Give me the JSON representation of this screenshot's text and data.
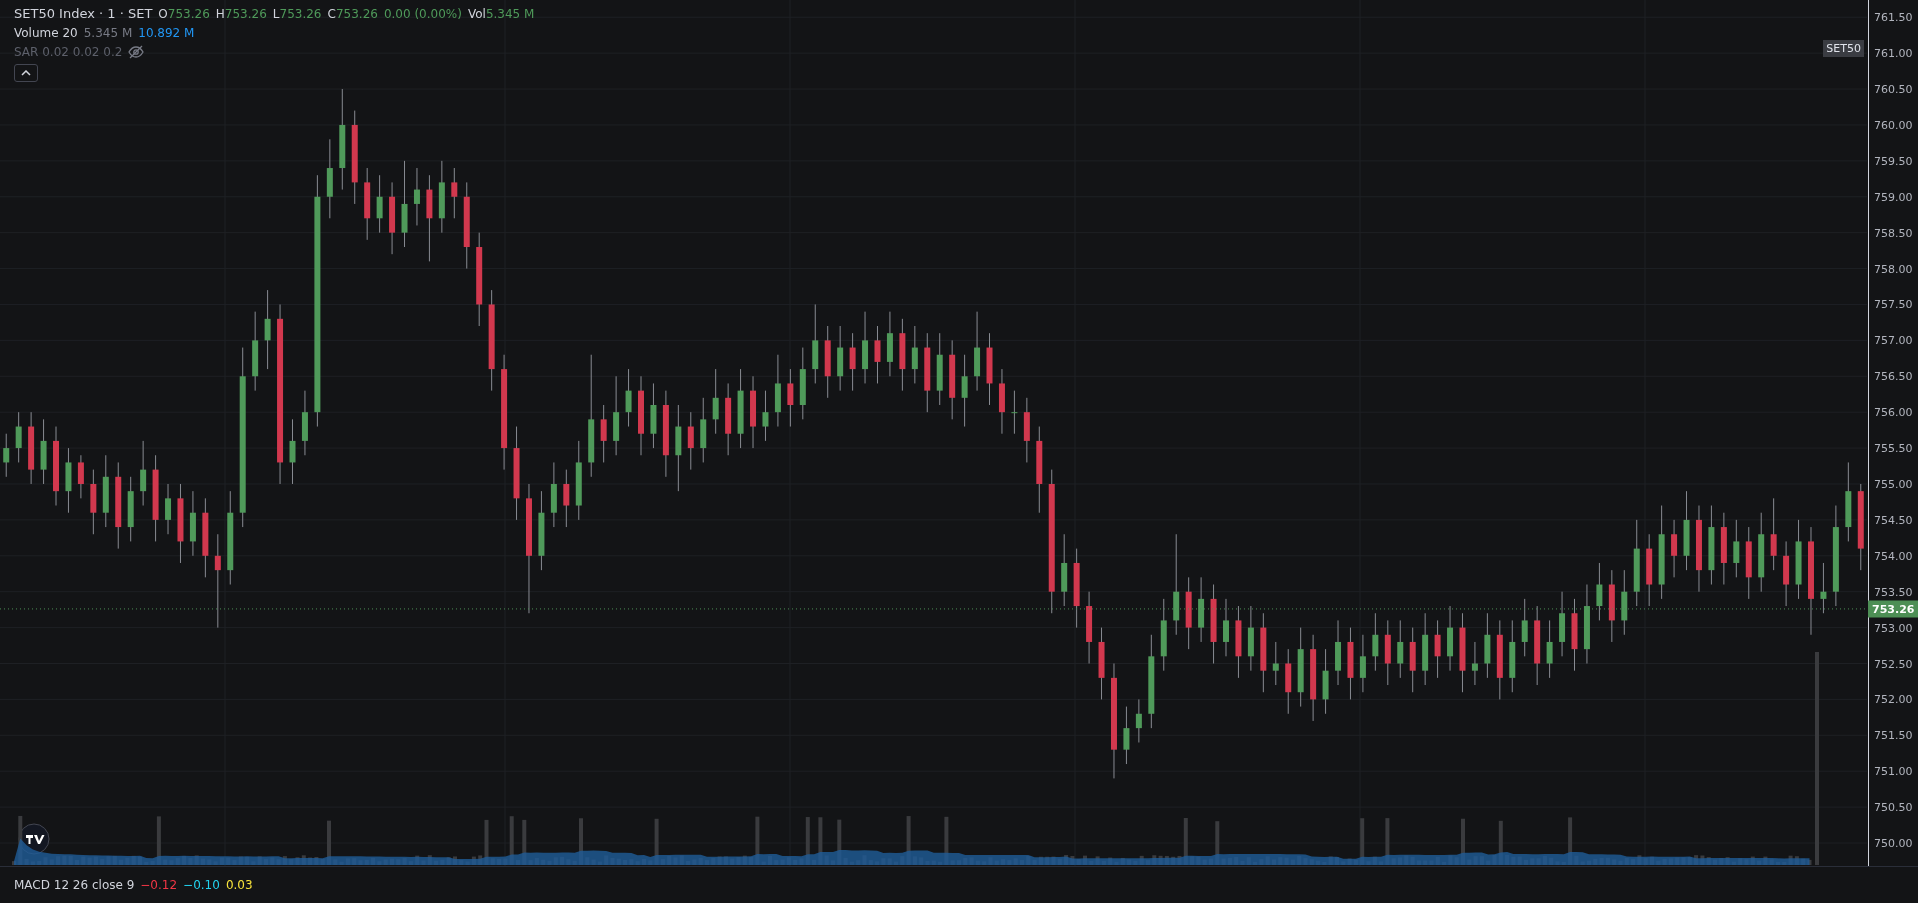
{
  "legend": {
    "title": "SET50 Index · 1 · SET",
    "ohlc": [
      {
        "label": "O",
        "value": "753.26"
      },
      {
        "label": "H",
        "value": "753.26"
      },
      {
        "label": "L",
        "value": "753.26"
      },
      {
        "label": "C",
        "value": "753.26"
      }
    ],
    "change": "0.00 (0.00%)",
    "volume_label": "Vol",
    "volume_value": "5.345 M"
  },
  "indicators": [
    {
      "name": "Volume 20",
      "values": [
        {
          "text": "5.345 M",
          "color": "#787b86"
        },
        {
          "text": "10.892 M",
          "color": "#2196f3"
        }
      ],
      "hidden": false
    },
    {
      "name": "SAR 0.02 0.02 0.2",
      "hidden": true
    }
  ],
  "chart": {
    "chart_data": {
      "type": "candlestick",
      "yticks": [
        {
          "value": 761.5,
          "label": "761.50"
        },
        {
          "value": 761,
          "label": "761.00"
        },
        {
          "value": 760.5,
          "label": "760.50"
        },
        {
          "value": 760,
          "label": "760.00"
        },
        {
          "value": 759.5,
          "label": "759.50"
        },
        {
          "value": 759,
          "label": "759.00"
        },
        {
          "value": 758.5,
          "label": "758.50"
        },
        {
          "value": 758,
          "label": "758.00"
        },
        {
          "value": 757.5,
          "label": "757.50"
        },
        {
          "value": 757,
          "label": "757.00"
        },
        {
          "value": 756.5,
          "label": "756.50"
        },
        {
          "value": 756,
          "label": "756.00"
        },
        {
          "value": 755.5,
          "label": "755.50"
        },
        {
          "value": 755,
          "label": "755.00"
        },
        {
          "value": 754.5,
          "label": "754.50"
        },
        {
          "value": 754,
          "label": "754.00"
        },
        {
          "value": 753.5,
          "label": "753.50"
        },
        {
          "value": 753,
          "label": "753.00"
        },
        {
          "value": 752.5,
          "label": "752.50"
        },
        {
          "value": 752,
          "label": "752.00"
        },
        {
          "value": 751.5,
          "label": "751.50"
        },
        {
          "value": 751,
          "label": "751.00"
        },
        {
          "value": 750.5,
          "label": "750.50"
        },
        {
          "value": 750,
          "label": "750.00"
        }
      ],
      "ylim": [
        749.68,
        761.74
      ],
      "grid": true,
      "ref_lines": [
        {
          "axis": "y",
          "value": 753.26,
          "label": "753.26"
        }
      ],
      "ohlc": [
        [
          755.3,
          755.7,
          755.1,
          755.5
        ],
        [
          755.5,
          756.0,
          755.3,
          755.8
        ],
        [
          755.8,
          756.0,
          755.0,
          755.2
        ],
        [
          755.2,
          755.9,
          755.0,
          755.6
        ],
        [
          755.6,
          755.8,
          754.7,
          754.9
        ],
        [
          754.9,
          755.5,
          754.6,
          755.3
        ],
        [
          755.3,
          755.4,
          754.8,
          755.0
        ],
        [
          755.0,
          755.2,
          754.3,
          754.6
        ],
        [
          754.6,
          755.4,
          754.4,
          755.1
        ],
        [
          755.1,
          755.3,
          754.1,
          754.4
        ],
        [
          754.4,
          755.1,
          754.2,
          754.9
        ],
        [
          754.9,
          755.6,
          754.7,
          755.2
        ],
        [
          755.2,
          755.4,
          754.2,
          754.5
        ],
        [
          754.5,
          755.0,
          754.3,
          754.8
        ],
        [
          754.8,
          755.0,
          753.9,
          754.2
        ],
        [
          754.2,
          754.9,
          754.0,
          754.6
        ],
        [
          754.6,
          754.8,
          753.7,
          754.0
        ],
        [
          754.0,
          754.3,
          753.0,
          753.8
        ],
        [
          753.8,
          754.9,
          753.6,
          754.6
        ],
        [
          754.6,
          756.9,
          754.4,
          756.5
        ],
        [
          756.5,
          757.4,
          756.3,
          757.0
        ],
        [
          757.0,
          757.7,
          756.6,
          757.3
        ],
        [
          757.3,
          757.5,
          755.0,
          755.3
        ],
        [
          755.3,
          755.9,
          755.0,
          755.6
        ],
        [
          755.6,
          756.3,
          755.4,
          756.0
        ],
        [
          756.0,
          759.3,
          755.8,
          759.0
        ],
        [
          759.0,
          759.8,
          758.7,
          759.4
        ],
        [
          759.4,
          760.5,
          759.1,
          760.0
        ],
        [
          760.0,
          760.2,
          758.9,
          759.2
        ],
        [
          759.2,
          759.4,
          758.4,
          758.7
        ],
        [
          758.7,
          759.3,
          758.5,
          759.0
        ],
        [
          759.0,
          759.2,
          758.2,
          758.5
        ],
        [
          758.5,
          759.5,
          758.3,
          758.9
        ],
        [
          758.9,
          759.4,
          758.6,
          759.1
        ],
        [
          759.1,
          759.3,
          758.1,
          758.7
        ],
        [
          758.7,
          759.5,
          758.5,
          759.2
        ],
        [
          759.2,
          759.4,
          758.7,
          759.0
        ],
        [
          759.0,
          759.2,
          758.0,
          758.3
        ],
        [
          758.3,
          758.5,
          757.2,
          757.5
        ],
        [
          757.5,
          757.7,
          756.3,
          756.6
        ],
        [
          756.6,
          756.8,
          755.2,
          755.5
        ],
        [
          755.5,
          755.8,
          754.5,
          754.8
        ],
        [
          754.8,
          755.0,
          753.2,
          754.0
        ],
        [
          754.0,
          754.9,
          753.8,
          754.6
        ],
        [
          754.6,
          755.3,
          754.4,
          755.0
        ],
        [
          755.0,
          755.2,
          754.4,
          754.7
        ],
        [
          754.7,
          755.6,
          754.5,
          755.3
        ],
        [
          755.3,
          756.8,
          755.1,
          755.9
        ],
        [
          755.9,
          756.1,
          755.3,
          755.6
        ],
        [
          755.6,
          756.5,
          755.4,
          756.0
        ],
        [
          756.0,
          756.6,
          755.8,
          756.3
        ],
        [
          756.3,
          756.5,
          755.4,
          755.7
        ],
        [
          755.7,
          756.4,
          755.5,
          756.1
        ],
        [
          756.1,
          756.3,
          755.1,
          755.4
        ],
        [
          755.4,
          756.1,
          754.9,
          755.8
        ],
        [
          755.8,
          756.0,
          755.2,
          755.5
        ],
        [
          755.5,
          756.2,
          755.3,
          755.9
        ],
        [
          755.9,
          756.6,
          755.7,
          756.2
        ],
        [
          756.2,
          756.4,
          755.4,
          755.7
        ],
        [
          755.7,
          756.6,
          755.5,
          756.3
        ],
        [
          756.3,
          756.5,
          755.5,
          755.8
        ],
        [
          755.8,
          756.3,
          755.6,
          756.0
        ],
        [
          756.0,
          756.8,
          755.8,
          756.4
        ],
        [
          756.4,
          756.6,
          755.8,
          756.1
        ],
        [
          756.1,
          756.9,
          755.9,
          756.6
        ],
        [
          756.6,
          757.5,
          756.4,
          757.0
        ],
        [
          757.0,
          757.2,
          756.2,
          756.5
        ],
        [
          756.5,
          757.2,
          756.3,
          756.9
        ],
        [
          756.9,
          757.1,
          756.3,
          756.6
        ],
        [
          756.6,
          757.4,
          756.4,
          757.0
        ],
        [
          757.0,
          757.2,
          756.4,
          756.7
        ],
        [
          756.7,
          757.4,
          756.5,
          757.1
        ],
        [
          757.1,
          757.3,
          756.3,
          756.6
        ],
        [
          756.6,
          757.2,
          756.4,
          756.9
        ],
        [
          756.9,
          757.1,
          756.0,
          756.3
        ],
        [
          756.3,
          757.1,
          756.1,
          756.8
        ],
        [
          756.8,
          757.0,
          755.9,
          756.2
        ],
        [
          756.2,
          756.8,
          755.8,
          756.5
        ],
        [
          756.5,
          757.4,
          756.3,
          756.9
        ],
        [
          756.9,
          757.1,
          756.1,
          756.4
        ],
        [
          756.4,
          756.6,
          755.7,
          756.0
        ],
        [
          756.0,
          756.3,
          755.7,
          756.0
        ],
        [
          756.0,
          756.2,
          755.3,
          755.6
        ],
        [
          755.6,
          755.8,
          754.6,
          755.0
        ],
        [
          755.0,
          755.2,
          753.2,
          753.5
        ],
        [
          753.5,
          754.3,
          753.3,
          753.9
        ],
        [
          753.9,
          754.1,
          753.0,
          753.3
        ],
        [
          753.3,
          753.5,
          752.5,
          752.8
        ],
        [
          752.8,
          753.0,
          752.0,
          752.3
        ],
        [
          752.3,
          752.5,
          750.9,
          751.3
        ],
        [
          751.3,
          751.9,
          751.1,
          751.6
        ],
        [
          751.6,
          752.0,
          751.4,
          751.8
        ],
        [
          751.8,
          752.9,
          751.6,
          752.6
        ],
        [
          752.6,
          753.4,
          752.4,
          753.1
        ],
        [
          753.1,
          754.3,
          752.9,
          753.5
        ],
        [
          753.5,
          753.7,
          752.7,
          753.0
        ],
        [
          753.0,
          753.7,
          752.8,
          753.4
        ],
        [
          753.4,
          753.6,
          752.5,
          752.8
        ],
        [
          752.8,
          753.4,
          752.6,
          753.1
        ],
        [
          753.1,
          753.3,
          752.3,
          752.6
        ],
        [
          752.6,
          753.3,
          752.4,
          753.0
        ],
        [
          753.0,
          753.2,
          752.1,
          752.4
        ],
        [
          752.4,
          752.8,
          752.2,
          752.5
        ],
        [
          752.5,
          752.7,
          751.8,
          752.1
        ],
        [
          752.1,
          753.0,
          751.9,
          752.7
        ],
        [
          752.7,
          752.9,
          751.7,
          752.0
        ],
        [
          752.0,
          752.7,
          751.8,
          752.4
        ],
        [
          752.4,
          753.1,
          752.2,
          752.8
        ],
        [
          752.8,
          753.0,
          752.0,
          752.3
        ],
        [
          752.3,
          752.9,
          752.1,
          752.6
        ],
        [
          752.6,
          753.2,
          752.4,
          752.9
        ],
        [
          752.9,
          753.1,
          752.2,
          752.5
        ],
        [
          752.5,
          753.1,
          752.3,
          752.8
        ],
        [
          752.8,
          753.0,
          752.1,
          752.4
        ],
        [
          752.4,
          753.2,
          752.2,
          752.9
        ],
        [
          752.9,
          753.1,
          752.3,
          752.6
        ],
        [
          752.6,
          753.3,
          752.4,
          753.0
        ],
        [
          753.0,
          753.2,
          752.1,
          752.4
        ],
        [
          752.4,
          752.8,
          752.2,
          752.5
        ],
        [
          752.5,
          753.2,
          752.3,
          752.9
        ],
        [
          752.9,
          753.1,
          752.0,
          752.3
        ],
        [
          752.3,
          753.1,
          752.1,
          752.8
        ],
        [
          752.8,
          753.4,
          752.6,
          753.1
        ],
        [
          753.1,
          753.3,
          752.2,
          752.5
        ],
        [
          752.5,
          753.1,
          752.3,
          752.8
        ],
        [
          752.8,
          753.5,
          752.6,
          753.2
        ],
        [
          753.2,
          753.4,
          752.4,
          752.7
        ],
        [
          752.7,
          753.6,
          752.5,
          753.3
        ],
        [
          753.3,
          753.9,
          753.1,
          753.6
        ],
        [
          753.6,
          753.8,
          752.8,
          753.1
        ],
        [
          753.1,
          753.8,
          752.9,
          753.5
        ],
        [
          753.5,
          754.5,
          753.3,
          754.1
        ],
        [
          754.1,
          754.3,
          753.3,
          753.6
        ],
        [
          753.6,
          754.7,
          753.4,
          754.3
        ],
        [
          754.3,
          754.5,
          753.7,
          754.0
        ],
        [
          754.0,
          754.9,
          753.8,
          754.5
        ],
        [
          754.5,
          754.7,
          753.5,
          753.8
        ],
        [
          753.8,
          754.7,
          753.6,
          754.4
        ],
        [
          754.4,
          754.6,
          753.6,
          753.9
        ],
        [
          753.9,
          754.5,
          753.7,
          754.2
        ],
        [
          754.2,
          754.4,
          753.4,
          753.7
        ],
        [
          753.7,
          754.6,
          753.5,
          754.3
        ],
        [
          754.3,
          754.8,
          753.8,
          754.0
        ],
        [
          754.0,
          754.2,
          753.3,
          753.6
        ],
        [
          753.6,
          754.5,
          753.4,
          754.2
        ],
        [
          754.2,
          754.4,
          752.9,
          753.4
        ],
        [
          753.4,
          753.9,
          753.2,
          753.5
        ],
        [
          753.5,
          754.7,
          753.3,
          754.4
        ],
        [
          754.4,
          755.3,
          754.2,
          754.9
        ],
        [
          754.9,
          755.0,
          753.8,
          754.1
        ]
      ]
    },
    "label": "SET50"
  },
  "macd": {
    "name": "MACD 12 26 close 9",
    "values": [
      {
        "text": "−0.12",
        "color": "#f23645"
      },
      {
        "text": "−0.10",
        "color": "#22d3ee"
      },
      {
        "text": "0.03",
        "color": "#f7e23b"
      }
    ]
  }
}
